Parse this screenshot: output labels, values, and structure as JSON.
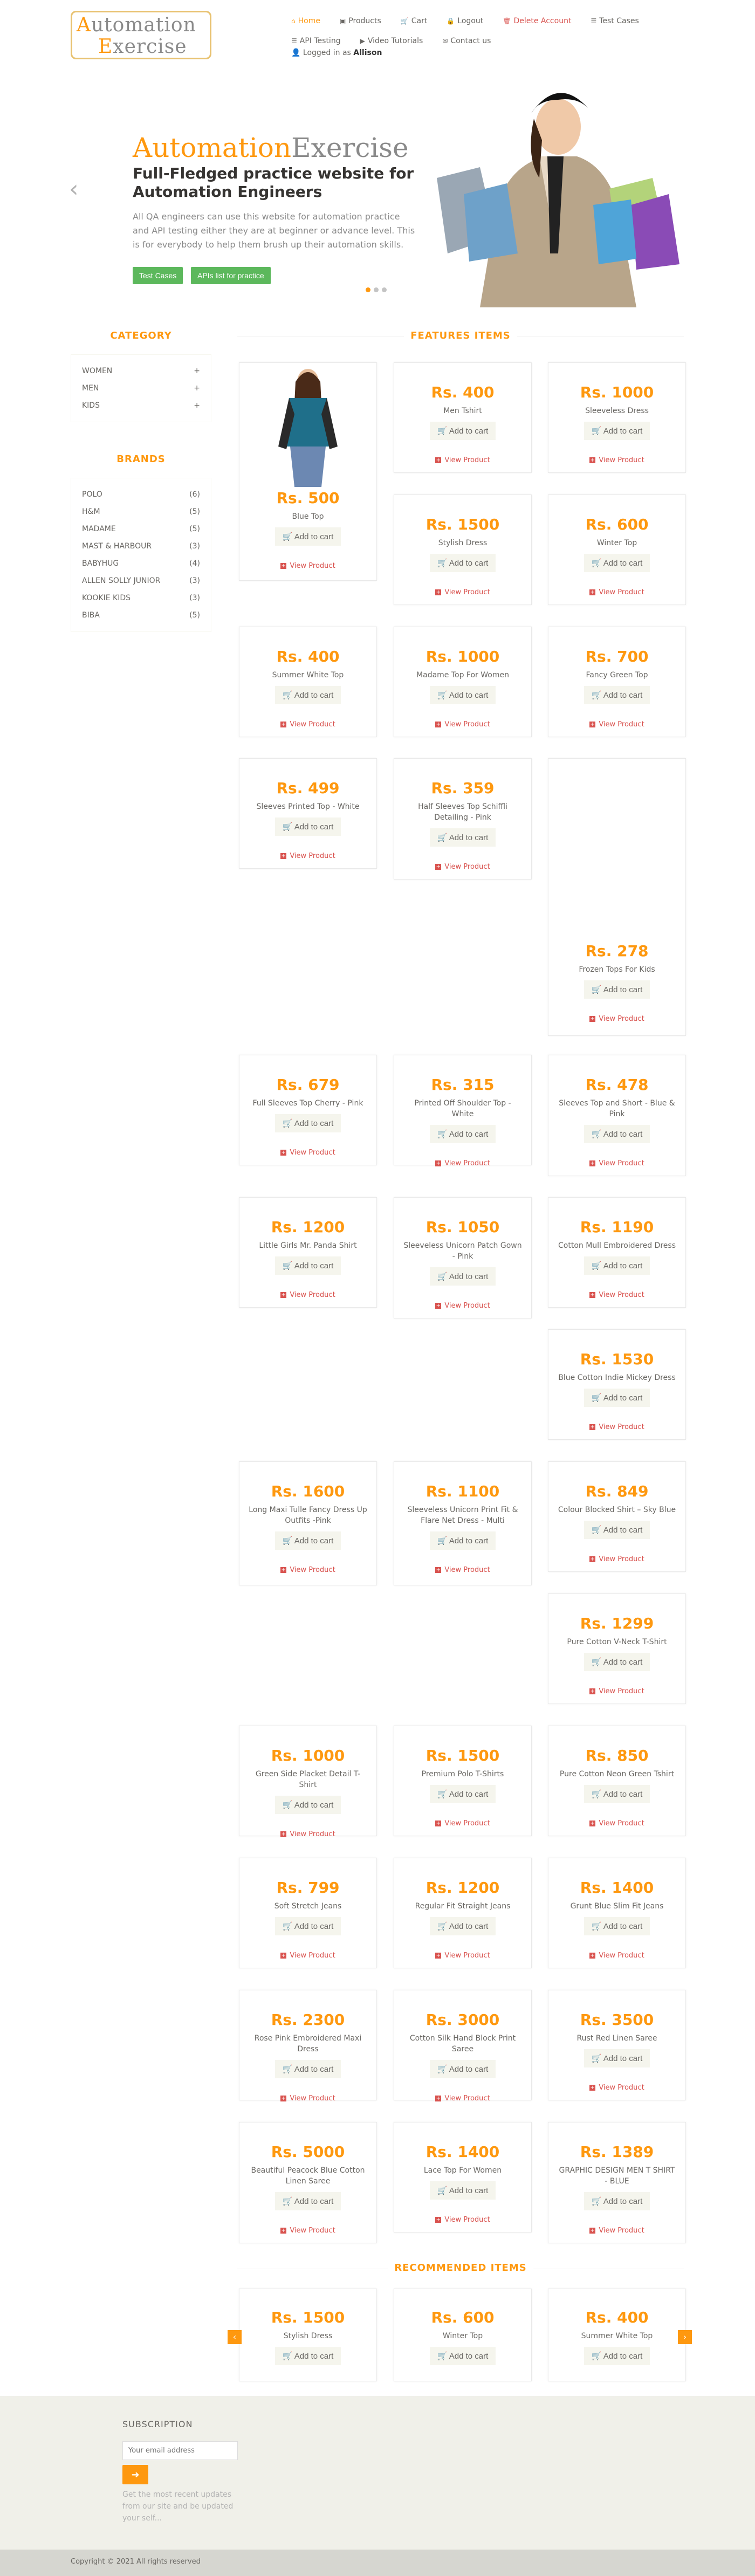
{
  "header": {
    "logo_line1": "Automation",
    "logo_line2": "Exercise",
    "nav": [
      {
        "label": "Home",
        "icon": "home-icon",
        "glyph": "⌂"
      },
      {
        "label": "Products",
        "icon": "products-icon",
        "glyph": "▣"
      },
      {
        "label": "Cart",
        "icon": "cart-icon",
        "glyph": "🛒"
      },
      {
        "label": "Logout",
        "icon": "lock-icon",
        "glyph": "🔒"
      },
      {
        "label": "Delete Account",
        "icon": "trash-icon",
        "glyph": "🗑"
      },
      {
        "label": "Test Cases",
        "icon": "list-icon",
        "glyph": "☰"
      },
      {
        "label": "API Testing",
        "icon": "list-icon",
        "glyph": "☰"
      },
      {
        "label": "Video Tutorials",
        "icon": "youtube-icon",
        "glyph": "▶"
      },
      {
        "label": "Contact us",
        "icon": "envelope-icon",
        "glyph": "✉"
      }
    ],
    "logged_in_label": "Logged in as",
    "logged_in_user": "Allison"
  },
  "slider": {
    "title_a": "Automation",
    "title_b": "Exercise",
    "heading": "Full-Fledged practice website for Automation Engineers",
    "text": "All QA engineers can use this website for automation practice and API testing either they are at beginner or advance level. This is for everybody to help them brush up their automation skills.",
    "btn_test_cases": "Test Cases",
    "btn_apis": "APIs list for practice",
    "prev": "‹",
    "next": "›"
  },
  "sidebar": {
    "category_title": "CATEGORY",
    "categories": [
      {
        "label": "WOMEN"
      },
      {
        "label": "MEN"
      },
      {
        "label": "KIDS"
      }
    ],
    "brands_title": "BRANDS",
    "brands": [
      {
        "name": "POLO",
        "count": "(6)"
      },
      {
        "name": "H&M",
        "count": "(5)"
      },
      {
        "name": "MADAME",
        "count": "(5)"
      },
      {
        "name": "MAST & HARBOUR",
        "count": "(3)"
      },
      {
        "name": "BABYHUG",
        "count": "(4)"
      },
      {
        "name": "ALLEN SOLLY JUNIOR",
        "count": "(3)"
      },
      {
        "name": "KOOKIE KIDS",
        "count": "(3)"
      },
      {
        "name": "BIBA",
        "count": "(5)"
      }
    ]
  },
  "features": {
    "title": "FEATURES ITEMS",
    "add_label": "Add to cart",
    "view_label": "View Product",
    "products": [
      {
        "price": "Rs. 500",
        "name": "Blue Top"
      },
      {
        "price": "Rs. 400",
        "name": "Men Tshirt"
      },
      {
        "price": "Rs. 1000",
        "name": "Sleeveless Dress"
      },
      {
        "price": "Rs. 1500",
        "name": "Stylish Dress"
      },
      {
        "price": "Rs. 600",
        "name": "Winter Top"
      },
      {
        "price": "Rs. 400",
        "name": "Summer White Top"
      },
      {
        "price": "Rs. 1000",
        "name": "Madame Top For Women"
      },
      {
        "price": "Rs. 700",
        "name": "Fancy Green Top"
      },
      {
        "price": "Rs. 499",
        "name": "Sleeves Printed Top - White"
      },
      {
        "price": "Rs. 359",
        "name": "Half Sleeves Top Schiffli Detailing - Pink"
      },
      {
        "price": "Rs. 278",
        "name": "Frozen Tops For Kids"
      },
      {
        "price": "Rs. 679",
        "name": "Full Sleeves Top Cherry - Pink"
      },
      {
        "price": "Rs. 315",
        "name": "Printed Off Shoulder Top - White"
      },
      {
        "price": "Rs. 478",
        "name": "Sleeves Top and Short - Blue & Pink"
      },
      {
        "price": "Rs. 1200",
        "name": "Little Girls Mr. Panda Shirt"
      },
      {
        "price": "Rs. 1050",
        "name": "Sleeveless Unicorn Patch Gown - Pink"
      },
      {
        "price": "Rs. 1190",
        "name": "Cotton Mull Embroidered Dress"
      },
      {
        "price": "Rs. 1530",
        "name": "Blue Cotton Indie Mickey Dress"
      },
      {
        "price": "Rs. 1600",
        "name": "Long Maxi Tulle Fancy Dress Up Outfits -Pink"
      },
      {
        "price": "Rs. 1100",
        "name": "Sleeveless Unicorn Print Fit & Flare Net Dress - Multi"
      },
      {
        "price": "Rs. 849",
        "name": "Colour Blocked Shirt – Sky Blue"
      },
      {
        "price": "Rs. 1299",
        "name": "Pure Cotton V-Neck T-Shirt"
      },
      {
        "price": "Rs. 1000",
        "name": "Green Side Placket Detail T-Shirt"
      },
      {
        "price": "Rs. 1500",
        "name": "Premium Polo T-Shirts"
      },
      {
        "price": "Rs. 850",
        "name": "Pure Cotton Neon Green Tshirt"
      },
      {
        "price": "Rs. 799",
        "name": "Soft Stretch Jeans"
      },
      {
        "price": "Rs. 1200",
        "name": "Regular Fit Straight Jeans"
      },
      {
        "price": "Rs. 1400",
        "name": "Grunt Blue Slim Fit Jeans"
      },
      {
        "price": "Rs. 2300",
        "name": "Rose Pink Embroidered Maxi Dress"
      },
      {
        "price": "Rs. 3000",
        "name": "Cotton Silk Hand Block Print Saree"
      },
      {
        "price": "Rs. 3500",
        "name": "Rust Red Linen Saree"
      },
      {
        "price": "Rs. 5000",
        "name": "Beautiful Peacock Blue Cotton Linen Saree"
      },
      {
        "price": "Rs. 1400",
        "name": "Lace Top For Women"
      },
      {
        "price": "Rs. 1389",
        "name": "GRAPHIC DESIGN MEN T SHIRT - BLUE"
      }
    ]
  },
  "recommended": {
    "title": "RECOMMENDED ITEMS",
    "items": [
      {
        "price": "Rs. 1500",
        "name": "Stylish Dress"
      },
      {
        "price": "Rs. 600",
        "name": "Winter Top"
      },
      {
        "price": "Rs. 400",
        "name": "Summer White Top"
      }
    ],
    "prev": "‹",
    "next": "›"
  },
  "footer": {
    "subscription_title": "SUBSCRIPTION",
    "email_placeholder": "Your email address",
    "subscribe_glyph": "➜",
    "subscription_text": "Get the most recent updates from our site and be updated your self...",
    "copyright": "Copyright © 2021 All rights reserved"
  },
  "colors": {
    "accent": "#FE980F",
    "danger": "#d9534f",
    "success": "#5cb85c",
    "footer_bg": "#F0F0E9"
  }
}
